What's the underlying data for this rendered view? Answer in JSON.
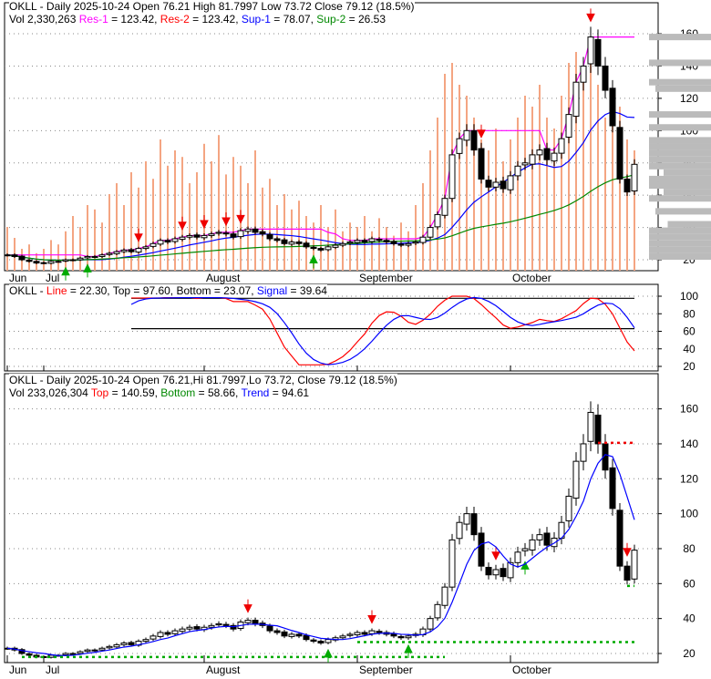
{
  "panel1": {
    "line1": {
      "symbol": "OKLL",
      "sep": " - ",
      "label": "Daily 2025-10-24 Open 76.21  High 81.7997  Low 73.72  Close 79.12 (18.5%)"
    },
    "line2": {
      "vol": "Vol 2,330,263 ",
      "res1": "Res-1",
      "res1_val": " = 123.42, ",
      "res2": "Res-2",
      "res2_val": " = 123.42, ",
      "sup1": "Sup-1",
      "sup1_val": " = 78.07, ",
      "sup2": "Sup-2",
      "sup2_val": " = 26.53"
    }
  },
  "panel2": {
    "prefix": "OKLL - ",
    "line": "Line",
    "line_val": " = 22.30, Top = 97.60, Bottom = 23.07, ",
    "signal": "Signal",
    "signal_val": " = 39.64"
  },
  "panel3": {
    "line1": "OKLL - Daily 2025-10-24 Open 76.21,Hi 81.7997,Lo 73.72, Close 79.12 (18.5%)",
    "line2": {
      "vol": "Vol 233,026,304 ",
      "top": "Top",
      "top_val": " = 140.59, ",
      "bottom": "Bottom",
      "bottom_val": " = 58.66, ",
      "trend": "Trend",
      "trend_val": " = 94.61"
    }
  },
  "chart_data": {
    "type": "candlestick",
    "x_labels": [
      {
        "label": "Jun",
        "index": 0
      },
      {
        "label": "Jul",
        "index": 5
      },
      {
        "label": "August",
        "index": 27
      },
      {
        "label": "September",
        "index": 48
      },
      {
        "label": "October",
        "index": 69
      }
    ],
    "price_ticks": [
      20,
      40,
      60,
      80,
      100,
      120,
      140,
      160
    ],
    "osc_ticks": [
      20,
      40,
      60,
      80,
      100
    ],
    "closes": [
      23,
      22,
      20,
      19,
      18,
      18,
      19,
      19,
      20,
      20,
      21,
      22,
      22,
      23,
      24,
      25,
      26,
      25,
      27,
      28,
      30,
      32,
      31,
      33,
      34,
      35,
      34,
      35,
      36,
      37,
      36,
      34,
      38,
      39,
      37,
      36,
      33,
      32,
      30,
      31,
      30,
      28,
      27,
      26,
      28,
      29,
      30,
      31,
      32,
      31,
      33,
      32,
      31,
      30,
      29,
      30,
      31,
      34,
      40,
      48,
      58,
      85,
      95,
      100,
      88,
      70,
      65,
      68,
      64,
      72,
      78,
      80,
      85,
      88,
      82,
      86,
      95,
      110,
      130,
      140,
      158,
      140,
      125,
      103,
      70,
      62,
      79.12
    ],
    "volume": [
      20,
      15,
      10,
      12,
      8,
      10,
      14,
      12,
      18,
      25,
      20,
      30,
      28,
      22,
      35,
      40,
      30,
      45,
      38,
      50,
      42,
      60,
      48,
      55,
      52,
      40,
      45,
      58,
      50,
      62,
      44,
      52,
      48,
      40,
      55,
      38,
      42,
      30,
      35,
      28,
      32,
      25,
      22,
      30,
      20,
      28,
      18,
      22,
      20,
      25,
      18,
      24,
      20,
      16,
      22,
      18,
      30,
      40,
      55,
      70,
      90,
      95,
      85,
      80,
      70,
      60,
      55,
      65,
      50,
      60,
      70,
      80,
      75,
      85,
      70,
      65,
      80,
      95,
      100,
      90,
      98,
      85,
      70,
      80,
      75,
      60,
      55
    ],
    "down_arrows_p1": [
      18,
      24,
      27,
      30,
      32,
      65,
      80
    ],
    "up_arrows_p1": [
      8,
      11,
      42
    ],
    "down_arrows_p3": [
      33,
      50,
      67,
      85
    ],
    "up_arrows_p3": [
      44,
      55,
      71
    ],
    "res1": 123.42,
    "sup1": 78.07,
    "sup2": 26.53,
    "top": 140.59,
    "bottom": 58.66,
    "trend": 94.61,
    "colors": {
      "up": "#ffffff",
      "down": "#000000",
      "volume": "#f4a582",
      "res": "#ff00ff",
      "sup1": "#0000ff",
      "sup2": "#008800",
      "line": "#ff0000",
      "signal": "#0000ff"
    }
  }
}
